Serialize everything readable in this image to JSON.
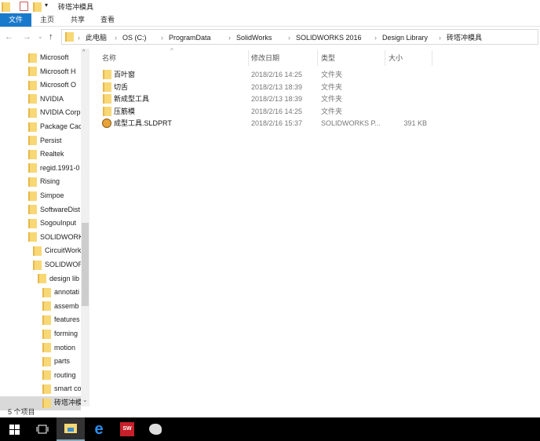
{
  "window": {
    "title": "砖塔冲模具"
  },
  "ribbon": {
    "tabs": [
      "文件",
      "主页",
      "共享",
      "查看"
    ]
  },
  "address": {
    "crumbs": [
      "此电脑",
      "OS (C:)",
      "ProgramData",
      "SolidWorks",
      "SOLIDWORKS 2016",
      "Design Library",
      "砖塔冲模具"
    ]
  },
  "tree": [
    {
      "label": "Microsoft",
      "level": 0
    },
    {
      "label": "Microsoft H",
      "level": 0
    },
    {
      "label": "Microsoft O",
      "level": 0
    },
    {
      "label": "NVIDIA",
      "level": 0
    },
    {
      "label": "NVIDIA Corp",
      "level": 0
    },
    {
      "label": "Package Cac",
      "level": 0
    },
    {
      "label": "Persist",
      "level": 0
    },
    {
      "label": "Realtek",
      "level": 0
    },
    {
      "label": "regid.1991-0",
      "level": 0
    },
    {
      "label": "Rising",
      "level": 0
    },
    {
      "label": "Simpoe",
      "level": 0
    },
    {
      "label": "SoftwareDist",
      "level": 0
    },
    {
      "label": "SogouInput",
      "level": 0
    },
    {
      "label": "SOLIDWORKS",
      "level": 0
    },
    {
      "label": "CircuitWork",
      "level": 1
    },
    {
      "label": "SOLIDWORKS",
      "level": 1
    },
    {
      "label": "design lib",
      "level": 2
    },
    {
      "label": "annotati",
      "level": 3
    },
    {
      "label": "assemb",
      "level": 3
    },
    {
      "label": "features",
      "level": 3
    },
    {
      "label": "forming",
      "level": 3
    },
    {
      "label": "motion",
      "level": 3
    },
    {
      "label": "parts",
      "level": 3
    },
    {
      "label": "routing",
      "level": 3
    },
    {
      "label": "smart co",
      "level": 3
    },
    {
      "label": "砖塔冲模",
      "level": 3,
      "selected": true
    }
  ],
  "columns": {
    "name": "名称",
    "date": "修改日期",
    "type": "类型",
    "size": "大小"
  },
  "files": [
    {
      "name": "百叶窗",
      "date": "2018/2/16 14:25",
      "type": "文件夹",
      "size": "",
      "icon": "folder"
    },
    {
      "name": "切舌",
      "date": "2018/2/13 18:39",
      "type": "文件夹",
      "size": "",
      "icon": "folder"
    },
    {
      "name": "新成型工具",
      "date": "2018/2/13 18:39",
      "type": "文件夹",
      "size": "",
      "icon": "folder"
    },
    {
      "name": "压筋模",
      "date": "2018/2/16 14:25",
      "type": "文件夹",
      "size": "",
      "icon": "folder"
    },
    {
      "name": "成型工具.SLDPRT",
      "date": "2018/2/16 15:37",
      "type": "SOLIDWORKS P...",
      "size": "391 KB",
      "icon": "sldprt"
    }
  ],
  "status": {
    "count": "5 个项目"
  },
  "colors": {
    "accent": "#1979ca",
    "folder": "#f8d775",
    "taskbar": "#000000"
  }
}
